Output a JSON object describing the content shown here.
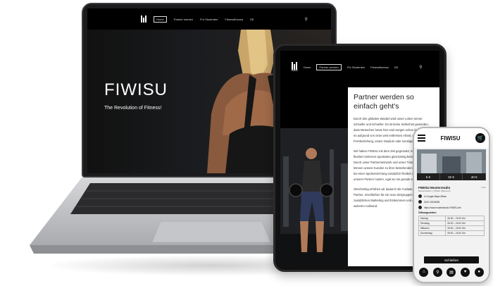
{
  "laptop": {
    "nav": {
      "items": [
        "Home",
        "Partner werden",
        "Für Studenten",
        "Fitnessfinessa",
        "DE"
      ]
    },
    "hero": {
      "title": "FIWISU",
      "subtitle": "The Revolution of Fitness!"
    }
  },
  "tablet": {
    "nav": {
      "logo_text": "FIWISU",
      "items": [
        "Home",
        "Partner werden",
        "Für Studenten",
        "Fitnessfinessa",
        "DE"
      ]
    },
    "card": {
      "title": "Partner werden so einfach geht's",
      "paragraphs": [
        "Durch den globalen Wandel wird unser Leben immer schneller und schneller. Es ist keine Seltenheit geworden, dass Menschen heute hier und morgen schon dort sind. Sei es aufgrund von einer weit entfernten Arbeit, einer Fernbeziehung, einem Studium oder sonstigem.",
        "Wir haben FIWISU mit dem Ziel gegründet, Menschen flexibel mehreren Sportarten gleichzeitig betreiben können. Durch unser Partnernetzwerk und unser Ticketsystem können unsere Kunden zu ihrer bestehenden Mitgliedschaft bei einer Sporteinrichtung zusätzlich flexibel alle Angebote unserer Partner nutzen, egal wo sie gerade sind.",
        "Gleichzeitig erhöhen wir dadurch die Auslastung unserer Partner, erschließen für sie neue Zielgruppen, bieten ihnen zusätzlichen Marketing und Einkommen und das ohne weiteren Aufwand."
      ]
    }
  },
  "phone": {
    "title": "FIWISU",
    "prices": [
      "5 €",
      "32 €",
      "40 €"
    ],
    "studio_name": "FIWISU Musterstudio",
    "studio_address": "Musterstraße 1 | 95444 | Bayreuth",
    "distance": "3 km",
    "maps_link": "In Google Maps öffnen",
    "phone_number": "0152 02918038",
    "website": "https://www.musterstudio-FIWISU.de/",
    "hours_heading": "Öffnungszeiten:",
    "hours": [
      {
        "day": "Montag",
        "time": "06:00 – 24:00 Uhr"
      },
      {
        "day": "Dienstag",
        "time": "06:00 – 24:00 Uhr"
      },
      {
        "day": "Mittwoch",
        "time": "06:00 – 24:00 Uhr"
      },
      {
        "day": "Donnerstag",
        "time": "06:00 – 24:00 Uhr"
      }
    ],
    "close_button": "Schließen"
  }
}
